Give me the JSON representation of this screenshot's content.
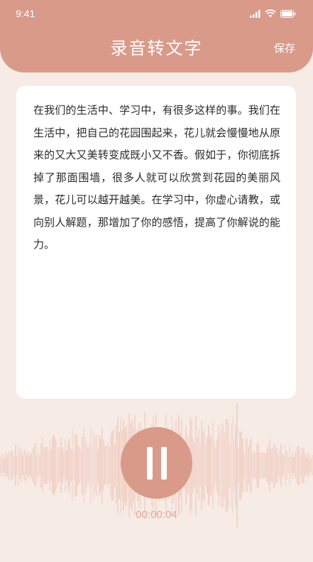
{
  "status_bar": {
    "time": "9:41"
  },
  "header": {
    "title": "录音转文字",
    "save_label": "保存"
  },
  "transcript": {
    "text": "在我们的生活中、学习中，有很多这样的事。我们在生活中，把自己的花园围起来，花儿就会慢慢地从原来的又大又美转变成既小又不香。假如于，你彻底拆掉了那面围墙，很多人就可以欣赏到花园的美丽风景，花儿可以越开越美。在学习中，你虚心请教，或向别人解题，那增加了你的感悟，提高了你解说的能力。"
  },
  "recorder": {
    "elapsed": "00:00:04",
    "state": "recording"
  },
  "colors": {
    "accent": "#d99a8a",
    "background": "#f6ebe5",
    "timer": "#e5a898"
  },
  "icons": [
    "signal-icon",
    "wifi-icon",
    "battery-icon",
    "pause-icon"
  ]
}
